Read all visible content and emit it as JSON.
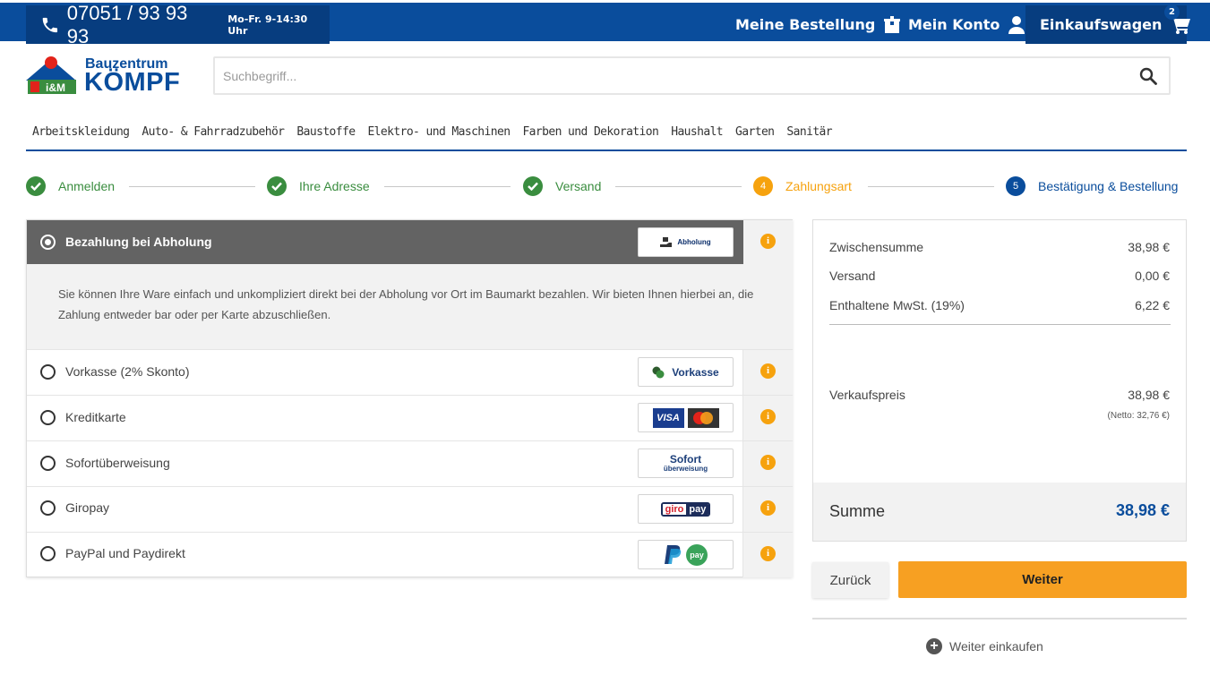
{
  "topbar": {
    "phone": "07051 / 93 93 93",
    "hours": "Mo-Fr. 9-14:30 Uhr",
    "order_link": "Meine Bestellung",
    "account_link": "Mein Konto",
    "cart_link": "Einkaufswagen",
    "cart_count": "2"
  },
  "header": {
    "logo_badge": "i&M",
    "logo_title": "Bauzentrum",
    "logo_name": "KÖMPF",
    "search_placeholder": "Suchbegriff..."
  },
  "nav": [
    "Arbeitskleidung",
    "Auto- & Fahrradzubehör",
    "Baustoffe",
    "Elektro- und Maschinen",
    "Farben und Dekoration",
    "Haushalt",
    "Garten",
    "Sanitär"
  ],
  "steps": [
    {
      "label": "Anmelden",
      "state": "done"
    },
    {
      "label": "Ihre Adresse",
      "state": "done"
    },
    {
      "label": "Versand",
      "state": "done"
    },
    {
      "number": "4",
      "label": "Zahlungsart",
      "state": "active"
    },
    {
      "number": "5",
      "label": "Bestätigung & Bestellung",
      "state": "todo"
    }
  ],
  "payment": {
    "selected": {
      "label": "Bezahlung bei Abholung",
      "logo_text": "Abholung",
      "description": "Sie können Ihre Ware einfach und unkompliziert direkt bei der Abholung vor Ort im Baumarkt bezahlen. Wir bieten Ihnen hierbei an, die Zahlung entweder bar oder per Karte abzuschließen."
    },
    "options": [
      {
        "label": "Vorkasse (2% Skonto)",
        "logo_text": "Vorkasse"
      },
      {
        "label": "Kreditkarte",
        "logo_text": "VISA"
      },
      {
        "label": "Sofortüberweisung",
        "logo_text": "Sofort",
        "logo_sub": "überweisung"
      },
      {
        "label": "Giropay",
        "logo_text": "giro",
        "logo_text2": "pay"
      },
      {
        "label": "PayPal und Paydirekt",
        "logo_text": "pay"
      }
    ],
    "info_glyph": "i"
  },
  "summary": {
    "subtotal_label": "Zwischensumme",
    "subtotal_value": "38,98 €",
    "shipping_label": "Versand",
    "shipping_value": "0,00 €",
    "vat_label": "Enthaltene MwSt. (19%)",
    "vat_value": "6,22 €",
    "price_label": "Verkaufspreis",
    "price_value": "38,98 €",
    "netto": "(Netto: 32,76 €)",
    "total_label": "Summe",
    "total_value": "38,98 €"
  },
  "actions": {
    "back": "Zurück",
    "next": "Weiter",
    "continue_shopping": "Weiter einkaufen"
  },
  "colors": {
    "brand_blue": "#0a4d9c",
    "success_green": "#3a8d3f",
    "accent_orange": "#f6a20e",
    "selected_gray": "#636363"
  }
}
